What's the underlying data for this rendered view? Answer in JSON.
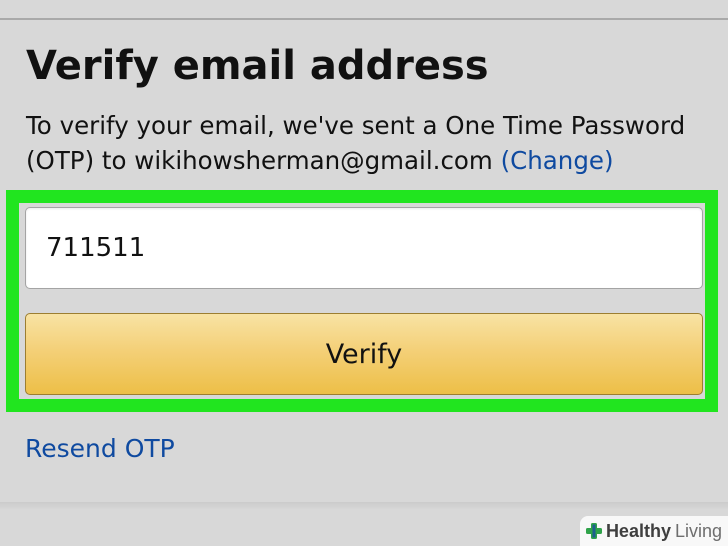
{
  "page": {
    "title": "Verify email address",
    "description_line1": "To verify your email, we've sent a One Time Password",
    "description_line2": "(OTP) to wikihowsherman@gmail.com",
    "change_link": "(Change)"
  },
  "form": {
    "otp_value": "711511",
    "verify_label": "Verify",
    "resend_label": "Resend OTP"
  },
  "watermark": {
    "brand_strong": "Healthy",
    "brand_light": "Living",
    "icon": "health-cross-icon"
  },
  "colors": {
    "background": "#d8d8d8",
    "highlight": "#21e51f",
    "link": "#0f4aa0",
    "button_top": "#f8e3a4",
    "button_bottom": "#edbf47"
  }
}
